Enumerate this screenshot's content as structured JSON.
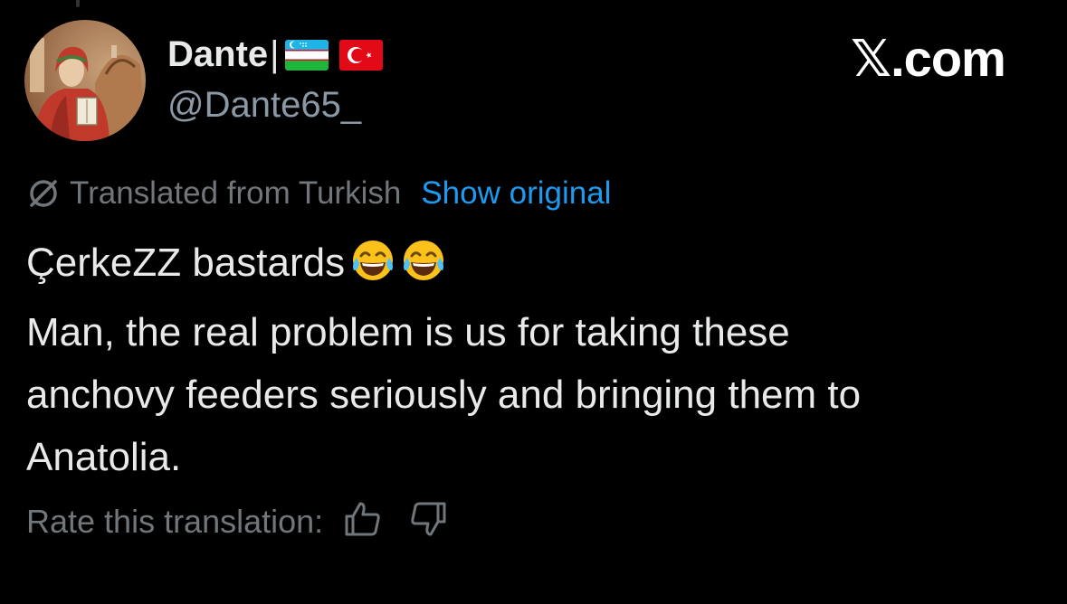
{
  "author": {
    "display_name": "Dante",
    "separator": "|",
    "flags": [
      "uzbekistan-flag",
      "turkey-flag"
    ],
    "handle": "@Dante65_"
  },
  "brand": {
    "label": "𝕏.com"
  },
  "translation": {
    "notice": "Translated from Turkish",
    "show_original": "Show original",
    "rate_label": "Rate this translation:"
  },
  "tweet": {
    "line1_text": "ÇerkeZZ bastards",
    "line1_emoji": [
      "face-with-tears-of-joy-emoji",
      "face-with-tears-of-joy-emoji"
    ],
    "lines": [
      "Man, the real problem is us for taking these",
      "anchovy feeders seriously and bringing them to",
      "Anatolia."
    ]
  },
  "colors": {
    "background": "#000000",
    "primary_text": "#e7e9ea",
    "secondary_text": "#71767b",
    "handle_text": "#8b98a5",
    "link": "#1d9bf0"
  },
  "icons": {
    "translated": "no-translation-icon",
    "thumb_up": "thumbs-up-icon",
    "thumb_down": "thumbs-down-icon"
  }
}
